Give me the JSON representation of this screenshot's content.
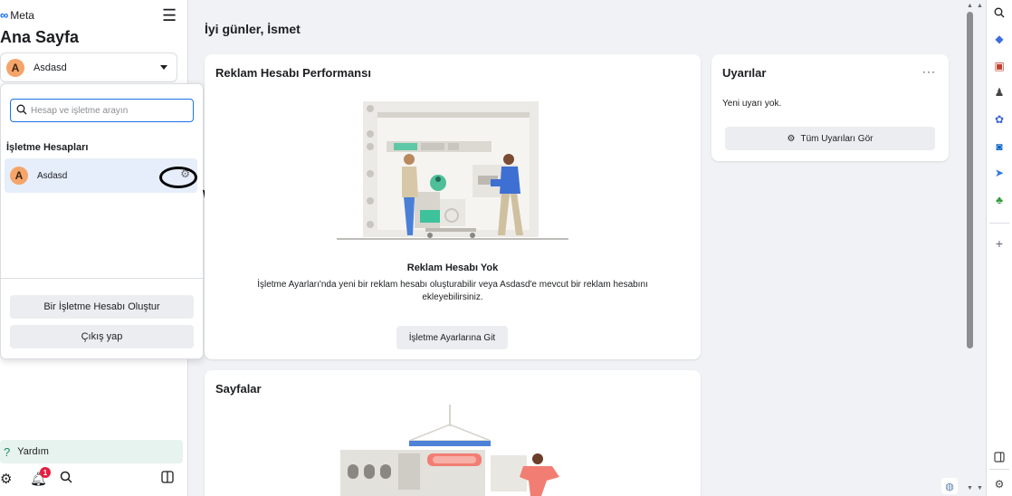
{
  "sidebar": {
    "brand": "Meta",
    "page_title": "Ana Sayfa",
    "account_initial": "A",
    "account_name": "Asdasd",
    "help_label": "Yardım",
    "notification_count": "1"
  },
  "dropdown": {
    "search_placeholder": "Hesap ve işletme arayın",
    "section_title": "İşletme Hesapları",
    "business_initial": "A",
    "business_name": "Asdasd",
    "create_button": "Bir İşletme Hesabı Oluştur",
    "logout_button": "Çıkış yap"
  },
  "main": {
    "greeting": "İyi günler, İsmet",
    "performance": {
      "title": "Reklam Hesabı Performansı",
      "empty_title": "Reklam Hesabı Yok",
      "empty_body": "İşletme Ayarları'nda yeni bir reklam hesabı oluşturabilir veya Asdasd'e mevcut bir reklam hesabını ekleyebilirsiniz.",
      "button": "İşletme Ayarlarına Git"
    },
    "alerts": {
      "title": "Uyarılar",
      "more": "···",
      "empty_text": "Yeni uyarı yok.",
      "button": "Tüm Uyarıları Gör"
    },
    "pages": {
      "title": "Sayfalar"
    }
  },
  "colors": {
    "accent": "#1b74e4",
    "avatar": "#f5a46a",
    "selected_row": "#e6eefb",
    "help_bg": "#e7f3ee",
    "badge": "#e41e3f"
  }
}
